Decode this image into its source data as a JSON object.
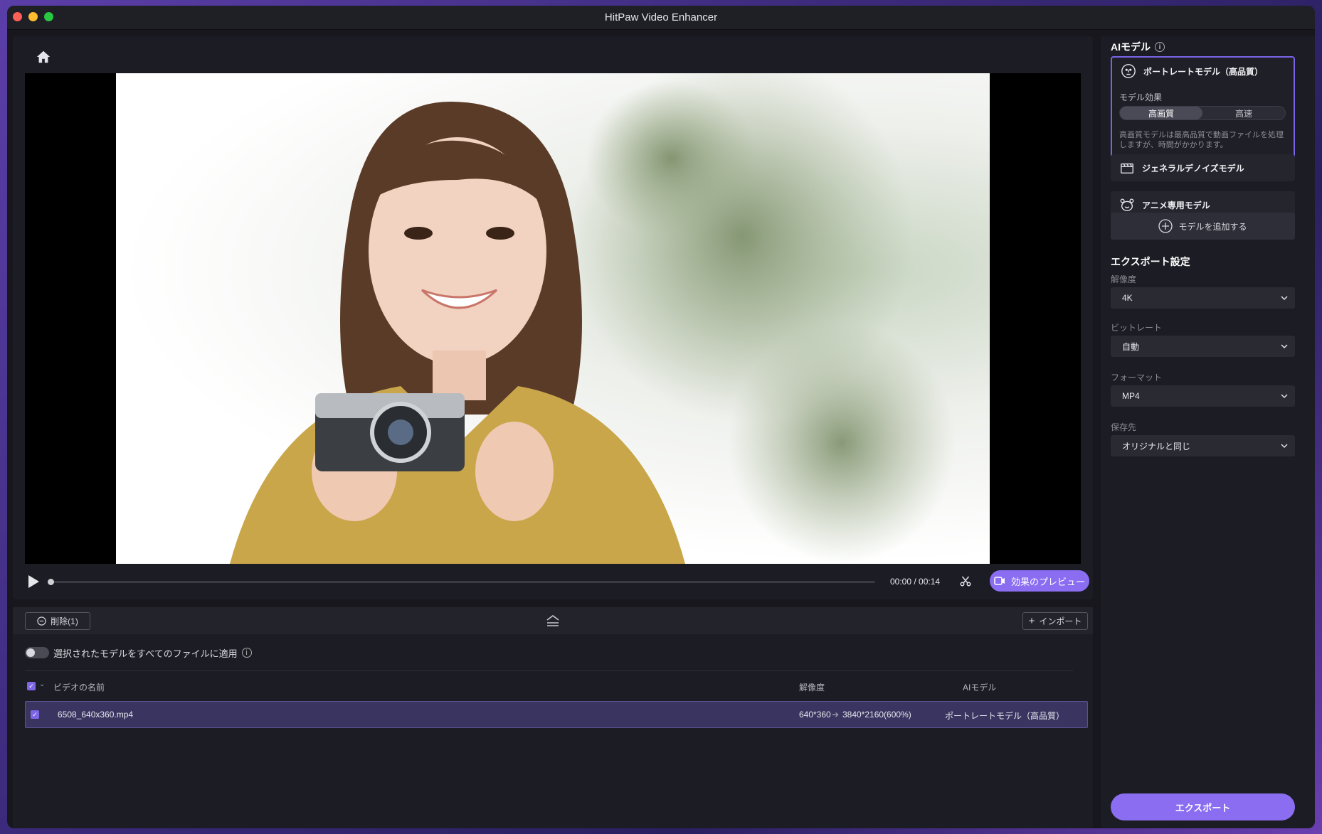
{
  "window": {
    "title": "HitPaw Video Enhancer"
  },
  "player": {
    "timecode": "00:00 / 00:14",
    "progress": 0,
    "preview_label": "効果のプレビュー"
  },
  "file_panel": {
    "delete_label": "削除(1)",
    "import_label": "インポート",
    "apply_all_label": "選択されたモデルをすべてのファイルに適用",
    "apply_all_enabled": false,
    "columns": {
      "name": "ビデオの名前",
      "resolution": "解像度",
      "model": "AIモデル"
    },
    "rows": [
      {
        "name": "6508_640x360.mp4",
        "res_from": "640*360",
        "res_to": "3840*2160(600%)",
        "model": "ポートレートモデル（高品質）",
        "checked": true
      }
    ]
  },
  "sidebar": {
    "ai_model_title": "AIモデル",
    "models": [
      {
        "label": "ポートレートモデル（高品質）",
        "icon": "portrait-face-icon",
        "selected": true,
        "effect_label": "モデル効果",
        "effect_options": [
          "高画質",
          "高速"
        ],
        "effect_selected": "高画質",
        "description": "高画質モデルは最高品質で動画ファイルを処理しますが、時間がかかります。"
      },
      {
        "label": "ジェネラルデノイズモデル",
        "icon": "film-clapper-icon",
        "selected": false
      },
      {
        "label": "アニメ専用モデル",
        "icon": "anime-bear-icon",
        "selected": false
      }
    ],
    "add_model_label": "モデルを追加する",
    "export_settings_title": "エクスポート設定",
    "fields": {
      "resolution": {
        "label": "解像度",
        "value": "4K"
      },
      "bitrate": {
        "label": "ビットレート",
        "value": "自動"
      },
      "format": {
        "label": "フォーマット",
        "value": "MP4"
      },
      "destination": {
        "label": "保存先",
        "value": "オリジナルと同じ"
      }
    },
    "export_label": "エクスポート"
  },
  "colors": {
    "accent": "#8a6df0",
    "panel": "#1c1c24",
    "selected_row": "#3a3560"
  }
}
